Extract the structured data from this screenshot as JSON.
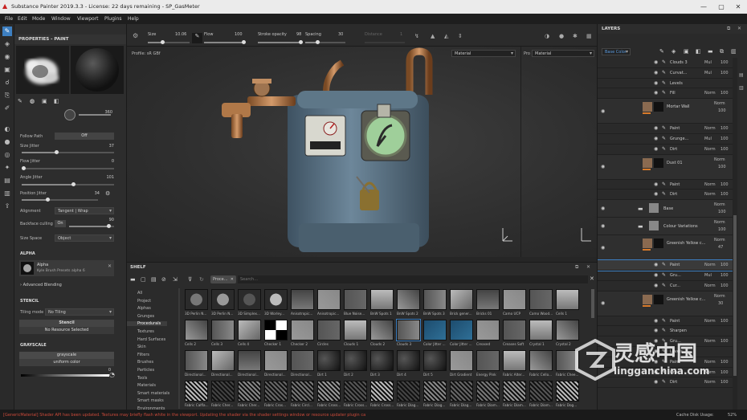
{
  "window": {
    "title": "Substance Painter 2019.3.3 - License: 22 days remaining - SP_GasMeter",
    "controls": [
      "—",
      "▢",
      "✕"
    ]
  },
  "menu": [
    "File",
    "Edit",
    "Mode",
    "Window",
    "Viewport",
    "Plugins",
    "Help"
  ],
  "context_bar": {
    "size": {
      "label": "Size",
      "value": "10.06"
    },
    "flow": {
      "label": "Flow",
      "value": "100"
    },
    "stroke": {
      "label": "Stroke opacity",
      "value": "98"
    },
    "spacing": {
      "label": "Spacing",
      "value": "30"
    },
    "distance": {
      "label": "Distance",
      "value": "1"
    }
  },
  "properties": {
    "header": "PROPERTIES - PAINT",
    "angle_value": "360",
    "follow_path": {
      "label": "Follow Path",
      "value": "Off"
    },
    "sliders": [
      {
        "label": "Size Jitter",
        "value": "37",
        "fraction": 0.37
      },
      {
        "label": "Flow Jitter",
        "value": "0",
        "fraction": 0.0
      },
      {
        "label": "Angle Jitter",
        "value": "101",
        "fraction": 0.56
      },
      {
        "label": "Position Jitter",
        "value": "34",
        "fraction": 0.34
      }
    ],
    "alignment": {
      "label": "Alignment",
      "value": "Tangent | Wrap"
    },
    "backface": {
      "label": "Backface culling",
      "value": "On",
      "number": "90",
      "fraction": 0.9
    },
    "size_space": {
      "label": "Size Space",
      "value": "Object"
    },
    "alpha": {
      "header": "ALPHA",
      "name": "Alpha",
      "preset": "Kyle Brush Presets alpha 6",
      "blending": "Advanced Blending"
    },
    "stencil": {
      "header": "STENCIL",
      "tiling_label": "Tiling mode",
      "tiling_value": "No Tiling",
      "button": "Stencil",
      "resource": "No Resource Selected"
    },
    "grayscale": {
      "header": "GRAYSCALE",
      "name": "grayscale",
      "sub": "uniform color",
      "value": "0"
    }
  },
  "viewport": {
    "left_label": "Profile: sR GBf",
    "dropdown1": "Material",
    "dropdown2": "Material",
    "right_label": "Pro Material"
  },
  "shelf": {
    "header": "SHELF",
    "filter_tag": "Proce...",
    "search_placeholder": "Search...",
    "categories": [
      "All",
      "Project",
      "Alphas",
      "Grunges",
      "Procedurals",
      "Textures",
      "Hard Surfaces",
      "Skin",
      "Filters",
      "Brushes",
      "Particles",
      "Tools",
      "Materials",
      "Smart materials",
      "Smart masks",
      "Environments"
    ],
    "selected_category": "Procedurals",
    "rows": [
      [
        "3D Perlin N...",
        "3D Perlin N...",
        "3D Simplex...",
        "3D Worley...",
        "Anisotropic...",
        "Anisotropic...",
        "Blue Noise...",
        "BnW Spots 1",
        "BnW Spots 2",
        "BnW Spots 3",
        "Brick gener...",
        "Bricks 01",
        "Camo UCP",
        "Camo Wood...",
        "Cells 1"
      ],
      [
        "Cells 2",
        "Cells 3",
        "Cells 4",
        "Checker 1",
        "Checker 2",
        "Circles",
        "Clouds 1",
        "Clouds 2",
        "Clouds 3",
        "Color Jitter ...",
        "Color Jitter ...",
        "Creased",
        "Creases Soft",
        "Crystal 1",
        "Crystal 2"
      ],
      [
        "Directional...",
        "Directional...",
        "Directional...",
        "Directional...",
        "Directional...",
        "Dirt 1",
        "Dirt 2",
        "Dirt 3",
        "Dirt 4",
        "Dirt 5",
        "Dirt Gradient",
        "Energy Pink",
        "Fabric Alter...",
        "Fabric Cello...",
        "Fabric Chee..."
      ],
      [
        "Fabric Calfla...",
        "Fabric Cher...",
        "Fabric Cher...",
        "Fabric Cros...",
        "Fabric Circl...",
        "Fabric Cross...",
        "Fabric Cross...",
        "Fabric Cross...",
        "Fabric Diag...",
        "Fabric Diag...",
        "Fabric Diag...",
        "Fabric Diam...",
        "Fabric Diam...",
        "Fabric Diam...",
        "Fabric Dog..."
      ]
    ]
  },
  "layers": {
    "header": "LAYERS",
    "channel": "Base Color",
    "rows": [
      {
        "type": "effect",
        "name": "Clouds 3",
        "blend": "Mul",
        "op": "100"
      },
      {
        "type": "effect",
        "name": "Curvat...",
        "blend": "Mul",
        "op": "100"
      },
      {
        "type": "effect",
        "name": "Levels",
        "blend": "",
        "op": ""
      },
      {
        "type": "effect",
        "name": "Fill",
        "blend": "Norm",
        "op": "100"
      },
      {
        "type": "layer",
        "name": "Mortar Wall",
        "blend": "Norm",
        "op": "100"
      },
      {
        "type": "effect",
        "name": "Paint",
        "blend": "Norm",
        "op": "100"
      },
      {
        "type": "effect",
        "name": "Grunge...",
        "blend": "Mul",
        "op": "100"
      },
      {
        "type": "effect",
        "name": "Dirt",
        "blend": "Norm",
        "op": "100"
      },
      {
        "type": "layer",
        "name": "Dust 01",
        "blend": "Norm",
        "op": "100"
      },
      {
        "type": "effect",
        "name": "Paint",
        "blend": "Norm",
        "op": "100"
      },
      {
        "type": "effect",
        "name": "Dirt",
        "blend": "Norm",
        "op": "100"
      },
      {
        "type": "folder",
        "name": "Base",
        "blend": "Norm",
        "op": "100"
      },
      {
        "type": "folder",
        "name": "Colour Variations",
        "blend": "Norm",
        "op": "100"
      },
      {
        "type": "layer",
        "name": "Greenish Yellow c...",
        "blend": "Norm",
        "op": "47"
      },
      {
        "type": "effect",
        "name": "Paint",
        "blend": "Norm",
        "op": "100"
      },
      {
        "type": "effect",
        "name": "Gru...",
        "blend": "Mul",
        "op": "100"
      },
      {
        "type": "effect",
        "name": "Cur...",
        "blend": "Norm",
        "op": "100"
      },
      {
        "type": "layer",
        "name": "Greenish Yellow c...",
        "blend": "Norm",
        "op": "30"
      },
      {
        "type": "effect",
        "name": "Paint",
        "blend": "Norm",
        "op": "100"
      },
      {
        "type": "effect",
        "name": "Sharpen",
        "blend": "",
        "op": ""
      },
      {
        "type": "effect",
        "name": "Gru...",
        "blend": "Norm",
        "op": "100"
      },
      {
        "type": "effect",
        "name": "Levels",
        "blend": "",
        "op": ""
      },
      {
        "type": "effect",
        "name": "Paint",
        "blend": "Norm",
        "op": "100"
      },
      {
        "type": "effect",
        "name": "Gru...",
        "blend": "Norm",
        "op": "100"
      },
      {
        "type": "effect",
        "name": "Dirt",
        "blend": "Norm",
        "op": "100"
      }
    ]
  },
  "status": {
    "message": "[GenericMaterial] Shader API has been updated. Textures may briefly flash white in the viewport. Updating the shader via the shader settings window or resource updater plugin ca",
    "cache": "Cache Disk Usage:",
    "cache_value": "52%"
  },
  "watermark": {
    "brand": "灵感中国",
    "domain": "lingganchina.com"
  },
  "colors": {
    "accent": "#3d7fc1",
    "status_text": "#cc4a3a"
  }
}
